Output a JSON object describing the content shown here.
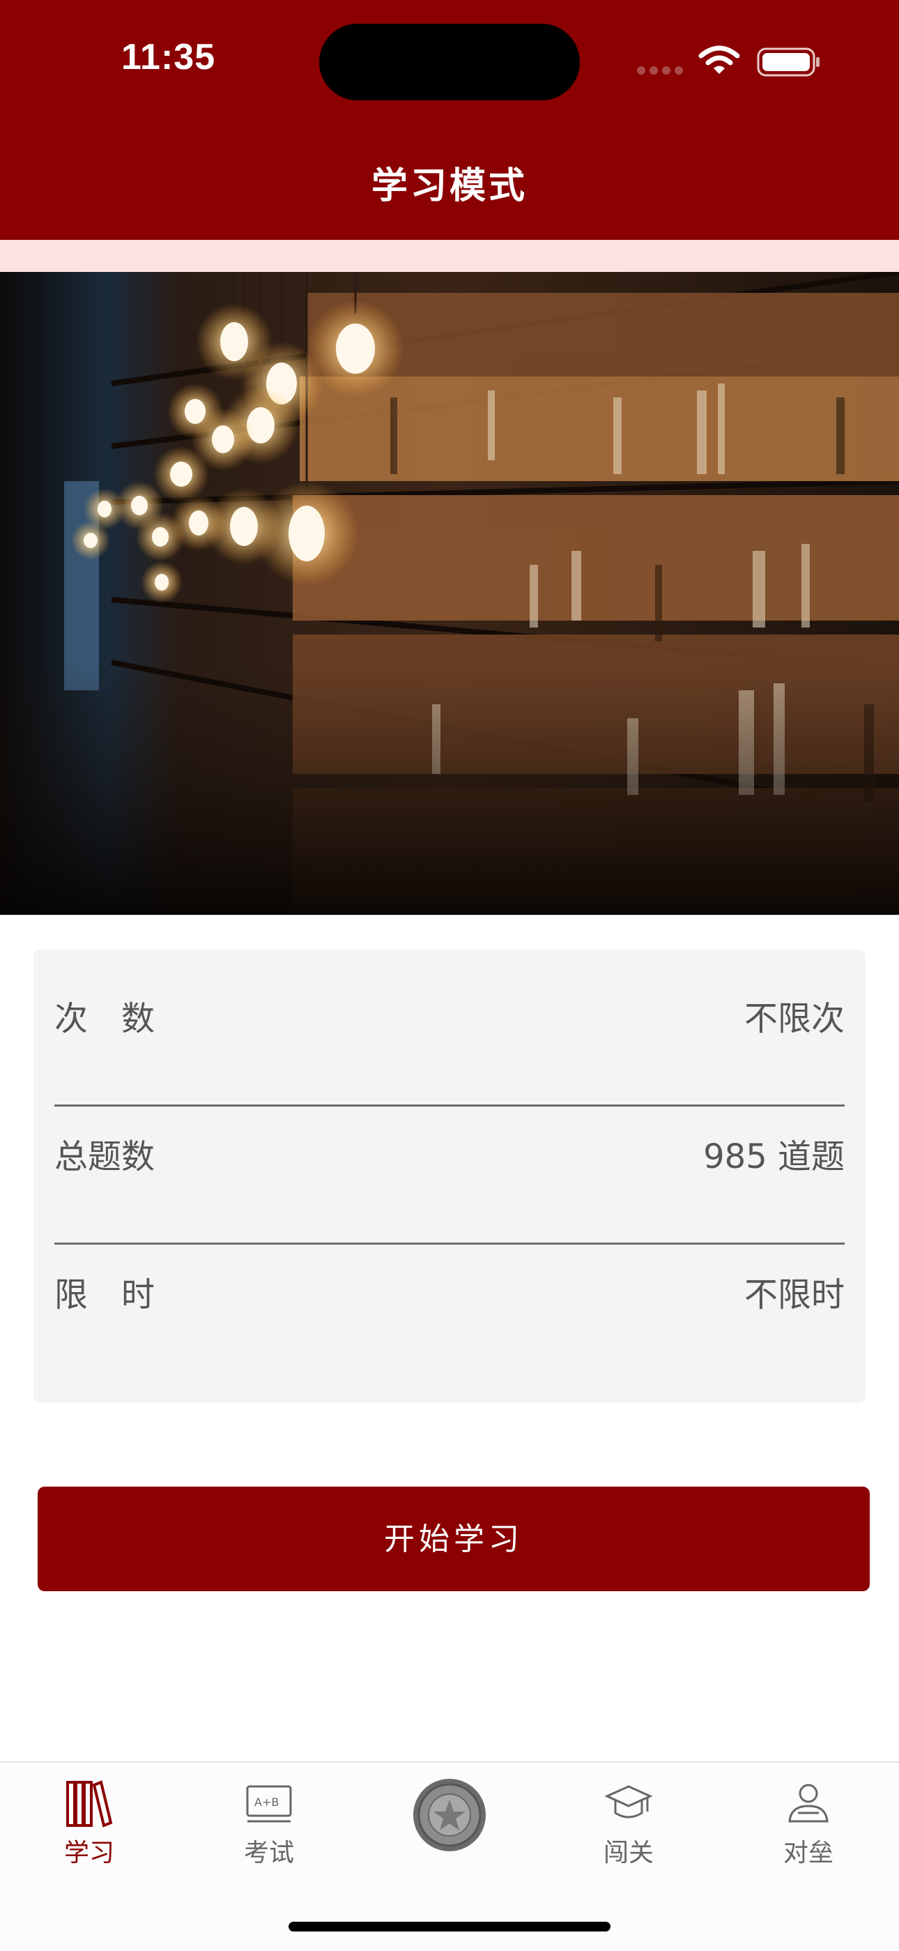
{
  "status_bar": {
    "time": "11:35"
  },
  "header": {
    "title": "学习模式"
  },
  "banner": {
    "icon": "library-bookshelf-photo"
  },
  "info": {
    "rows": [
      {
        "label": "次　数",
        "value": "不限次"
      },
      {
        "label": "总题数",
        "value": "985 道题"
      },
      {
        "label": "限　时",
        "value": "不限时"
      }
    ]
  },
  "start_button": {
    "label": "开始学习"
  },
  "tabbar": {
    "items": [
      {
        "label": "学习",
        "icon": "books-icon",
        "active": true
      },
      {
        "label": "考试",
        "icon": "exam-board-icon",
        "active": false
      },
      {
        "label": "",
        "icon": "emblem-icon",
        "active": false
      },
      {
        "label": "闯关",
        "icon": "graduation-cap-icon",
        "active": false
      },
      {
        "label": "对垒",
        "icon": "user-duel-icon",
        "active": false
      }
    ]
  },
  "colors": {
    "brand": "#8b0000",
    "strip": "#fbe3e0",
    "card": "#f5f4f3"
  }
}
